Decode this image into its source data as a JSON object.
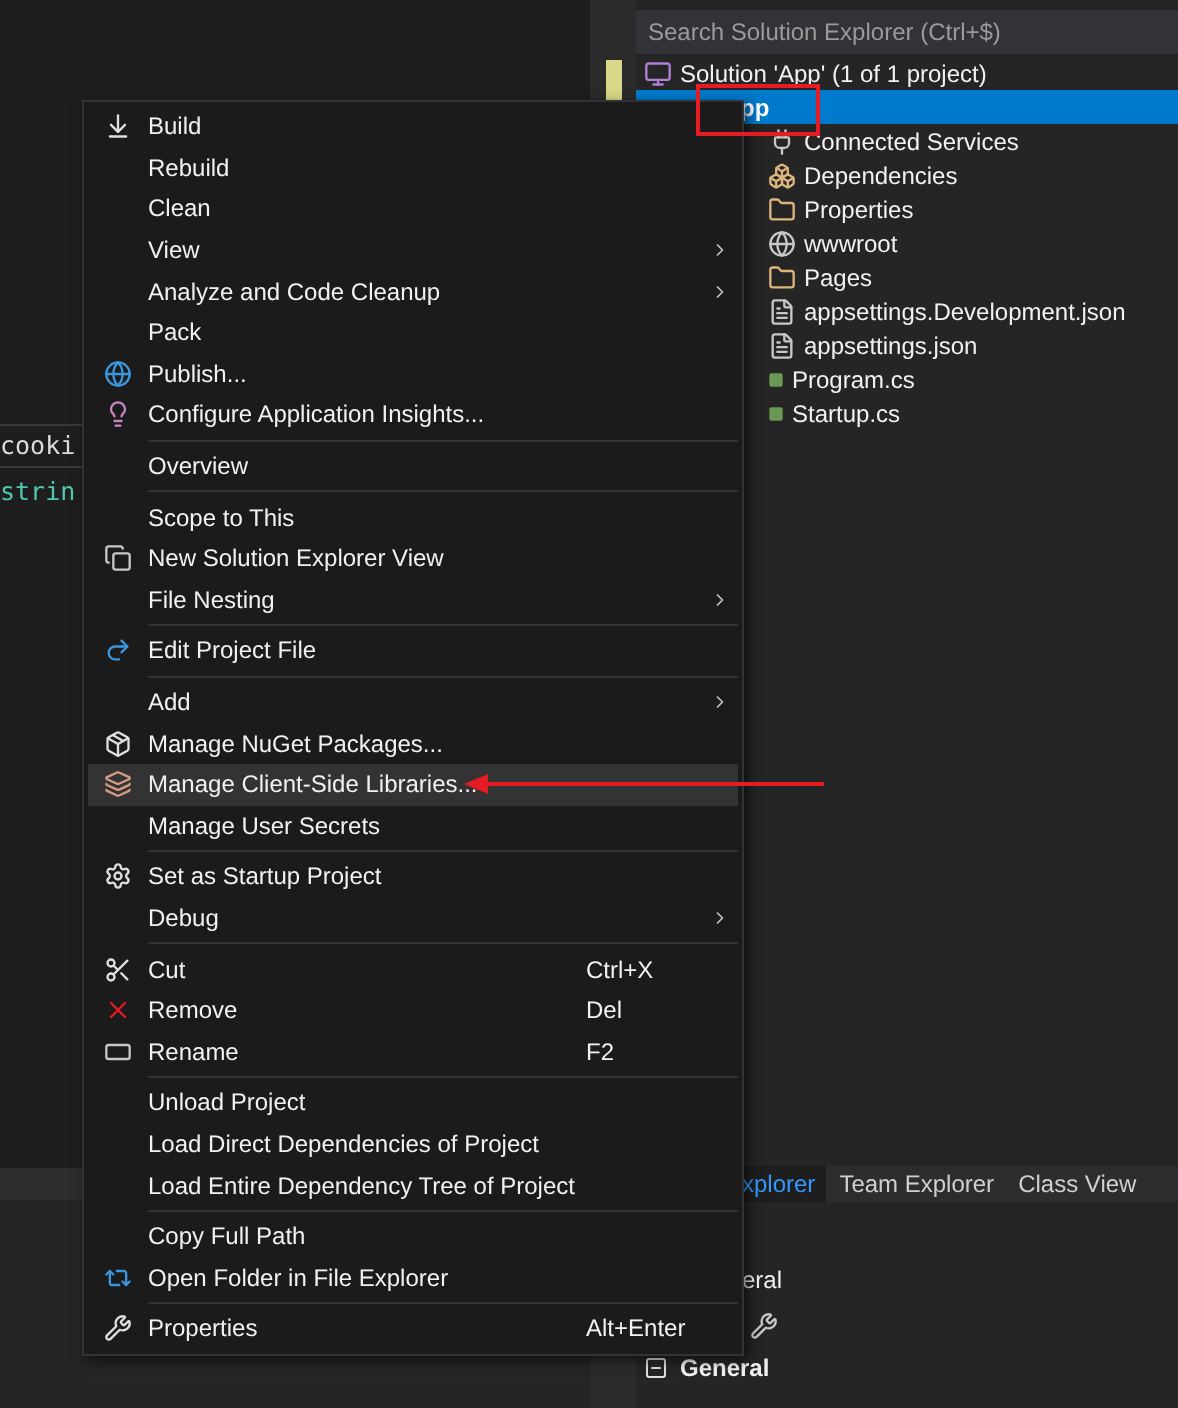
{
  "editor": {
    "code_lines": [
      {
        "text": "cooki",
        "kind": "plain"
      },
      {
        "text": "strin",
        "kind": "type"
      }
    ]
  },
  "solution_explorer": {
    "search": {
      "placeholder": "Search Solution Explorer (Ctrl+$)"
    },
    "tree": [
      {
        "label": "Solution 'App' (1 of 1 project)",
        "kind": "solution",
        "selected": false,
        "children": [
          {
            "label": "pp",
            "selected": true,
            "children": [
              {
                "label": "Connected Services",
                "kind": "connected",
                "selected": false
              },
              {
                "label": "Dependencies",
                "kind": "dependencies",
                "selected": false
              },
              {
                "label": "Properties",
                "kind": "folder",
                "selected": false
              },
              {
                "label": "wwwroot",
                "kind": "web",
                "selected": false
              },
              {
                "label": "Pages",
                "kind": "folder",
                "selected": false
              },
              {
                "label": "appsettings.Development.json",
                "kind": "json",
                "selected": false
              },
              {
                "label": "appsettings.json",
                "kind": "json",
                "selected": false
              },
              {
                "label": "Program.cs",
                "kind": "code",
                "selected": false
              },
              {
                "label": "Startup.cs",
                "kind": "code",
                "selected": false
              }
            ]
          }
        ]
      }
    ]
  },
  "bottom_tabs": [
    {
      "label": "xplorer",
      "selected": true
    },
    {
      "label": "Team Explorer",
      "selected": false
    },
    {
      "label": "Class View",
      "selected": false
    }
  ],
  "properties_panel": {
    "title": "eral",
    "section": {
      "label": "General",
      "expanded": true
    }
  },
  "context_menu": [
    {
      "kind": "build",
      "label": "Build",
      "submenu": false,
      "selected": false
    },
    {
      "kind": "plain",
      "label": "Rebuild",
      "submenu": false,
      "selected": false
    },
    {
      "kind": "plain",
      "label": "Clean",
      "submenu": false,
      "selected": false
    },
    {
      "kind": "plain",
      "label": "View",
      "submenu": true,
      "selected": false
    },
    {
      "kind": "plain",
      "label": "Analyze and Code Cleanup",
      "submenu": true,
      "selected": false
    },
    {
      "kind": "plain",
      "label": "Pack",
      "submenu": false,
      "selected": false
    },
    {
      "kind": "publish",
      "label": "Publish...",
      "submenu": false,
      "selected": false
    },
    {
      "kind": "insights",
      "label": "Configure Application Insights...",
      "submenu": false,
      "selected": false
    },
    {
      "kind": "separator"
    },
    {
      "kind": "plain",
      "label": "Overview",
      "submenu": false,
      "selected": false
    },
    {
      "kind": "separator"
    },
    {
      "kind": "plain",
      "label": "Scope to This",
      "submenu": false,
      "selected": false
    },
    {
      "kind": "new-view",
      "label": "New Solution Explorer View",
      "submenu": false,
      "selected": false
    },
    {
      "kind": "plain",
      "label": "File Nesting",
      "submenu": true,
      "selected": false
    },
    {
      "kind": "separator"
    },
    {
      "kind": "edit",
      "label": "Edit Project File",
      "submenu": false,
      "selected": false
    },
    {
      "kind": "separator"
    },
    {
      "kind": "plain",
      "label": "Add",
      "submenu": true,
      "selected": false
    },
    {
      "kind": "nuget",
      "label": "Manage NuGet Packages...",
      "submenu": false,
      "selected": false
    },
    {
      "kind": "libraries",
      "label": "Manage Client-Side Libraries...",
      "submenu": false,
      "selected": true
    },
    {
      "kind": "plain",
      "label": "Manage User Secrets",
      "submenu": false,
      "selected": false
    },
    {
      "kind": "separator"
    },
    {
      "kind": "startup",
      "label": "Set as Startup Project",
      "submenu": false,
      "selected": false
    },
    {
      "kind": "plain",
      "label": "Debug",
      "submenu": true,
      "selected": false
    },
    {
      "kind": "separator"
    },
    {
      "kind": "cut",
      "label": "Cut",
      "shortcut": "Ctrl+X",
      "submenu": false,
      "selected": false
    },
    {
      "kind": "remove",
      "label": "Remove",
      "shortcut": "Del",
      "submenu": false,
      "selected": false
    },
    {
      "kind": "rename",
      "label": "Rename",
      "shortcut": "F2",
      "submenu": false,
      "selected": false
    },
    {
      "kind": "separator"
    },
    {
      "kind": "plain",
      "label": "Unload Project",
      "submenu": false,
      "selected": false
    },
    {
      "kind": "plain",
      "label": "Load Direct Dependencies of Project",
      "submenu": false,
      "selected": false
    },
    {
      "kind": "plain",
      "label": "Load Entire Dependency Tree of Project",
      "submenu": false,
      "selected": false
    },
    {
      "kind": "separator"
    },
    {
      "kind": "plain",
      "label": "Copy Full Path",
      "submenu": false,
      "selected": false
    },
    {
      "kind": "open-folder",
      "label": "Open Folder in File Explorer",
      "submenu": false,
      "selected": false
    },
    {
      "kind": "separator"
    },
    {
      "kind": "properties",
      "label": "Properties",
      "shortcut": "Alt+Enter",
      "submenu": false,
      "selected": false
    }
  ]
}
